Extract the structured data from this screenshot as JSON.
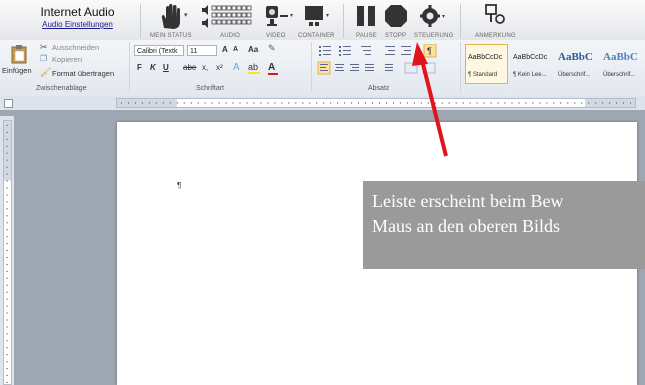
{
  "topbar": {
    "app_title": "Internet Audio",
    "settings_link": "Audio Einstellungen",
    "groups": [
      {
        "label": "MEIN STATUS",
        "icon": "hand-icon"
      },
      {
        "label": "AUDIO",
        "icon": "audio-level-icon"
      },
      {
        "label": "VIDEO",
        "icon": "webcam-icon"
      },
      {
        "label": "CONTAINER",
        "icon": "container-icon"
      },
      {
        "label": "PAUSE",
        "icon": "pause-icon"
      },
      {
        "label": "STOPP",
        "icon": "stop-icon"
      },
      {
        "label": "STEUERUNG",
        "icon": "gear-icon"
      },
      {
        "label": "ANMERKUNG",
        "icon": "annotation-icon"
      }
    ]
  },
  "ribbon": {
    "clipboard": {
      "paste": "Einfügen",
      "cut": "Ausschneiden",
      "copy": "Kopieren",
      "format_painter": "Format übertragen",
      "group_label": "Zwischenablage"
    },
    "font": {
      "family": "Calibri (Textk",
      "size": "11",
      "group_label": "Schriftart",
      "bold": "F",
      "italic": "K",
      "underline": "U",
      "strike": "abe",
      "subscript": "x,",
      "superscript": "x²",
      "grow": "A",
      "shrink": "A",
      "case": "Aa"
    },
    "paragraph": {
      "group_label": "Absatz",
      "pilcrow": "¶"
    },
    "styles": [
      {
        "preview": "AaBbCcDc",
        "name": "¶ Standard",
        "selected": true
      },
      {
        "preview": "AaBbCcDc",
        "name": "¶ Kein Lee...",
        "selected": false
      },
      {
        "preview": "AaBbC",
        "name": "Überschrif...",
        "selected": false
      },
      {
        "preview": "AaBbC",
        "name": "Überschrif...",
        "selected": false
      }
    ]
  },
  "document": {
    "pilcrow": "¶"
  },
  "callout": {
    "line1": "Leiste erscheint beim Bew",
    "line2": "Maus an den oberen Bilds"
  },
  "colors": {
    "arrow": "#e0141b",
    "callout_bg": "#9a9a9a",
    "accent": "#1a1a8a"
  }
}
